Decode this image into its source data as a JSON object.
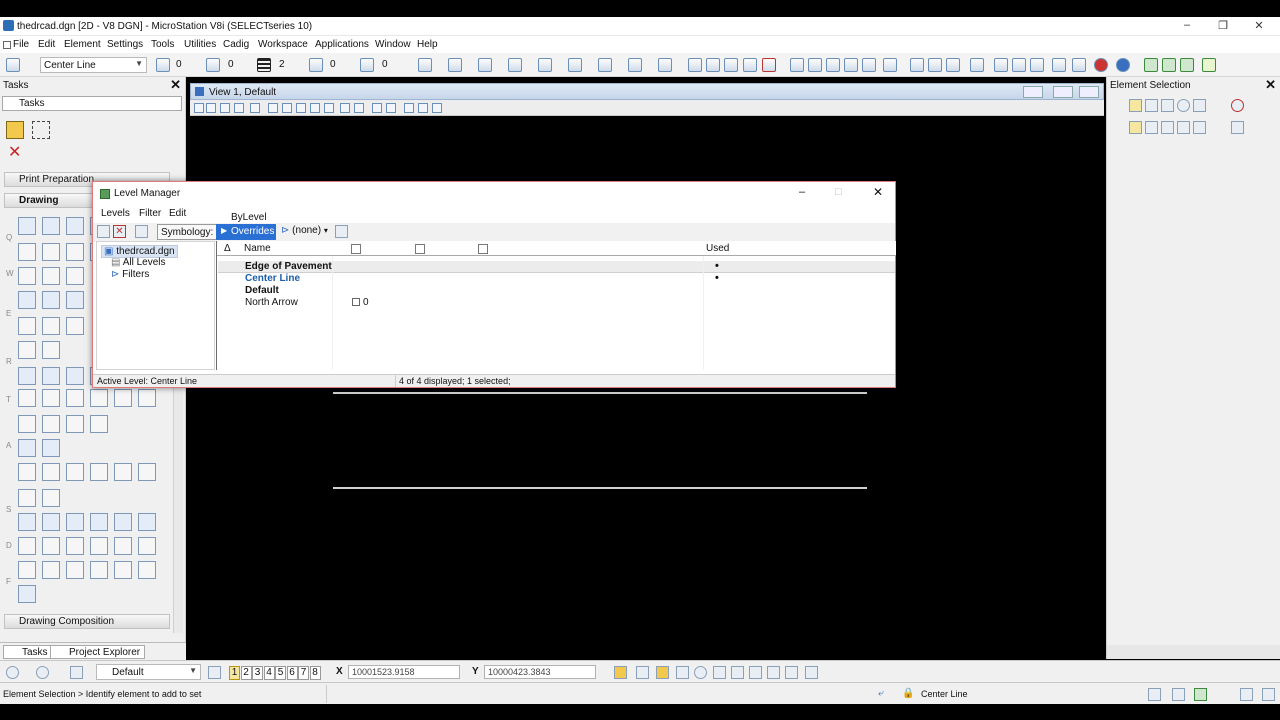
{
  "window": {
    "title": "thedrcad.dgn [2D - V8 DGN] - MicroStation V8i (SELECTseries 10)",
    "minimize": "–",
    "restore": "❐",
    "close": "✕"
  },
  "menu": [
    "File",
    "Edit",
    "Element",
    "Settings",
    "Tools",
    "Utilities",
    "Cadig",
    "Workspace",
    "Applications",
    "Window",
    "Help"
  ],
  "toolbar": {
    "level_combo": "Center Line",
    "color_value": "0",
    "style_value": "0",
    "weight_value": "2",
    "transparency_value": "0",
    "priority_value": "0"
  },
  "tasks_panel": {
    "title": "Tasks",
    "combo_value": "Tasks",
    "section_print": "Print Preparation",
    "section_drawing": "Drawing",
    "section_composition": "Drawing Composition",
    "side_letters": [
      "Q",
      "W",
      "E",
      "R",
      "T",
      "A",
      "S",
      "D",
      "F"
    ],
    "tabs": [
      "Tasks",
      "Project Explorer"
    ]
  },
  "view": {
    "title": "View 1, Default"
  },
  "right_panel": {
    "title": "Element Selection"
  },
  "level_manager": {
    "title": "Level Manager",
    "menu": [
      "Levels",
      "Filter",
      "Edit"
    ],
    "symbology_label": "Symbology:",
    "bylevel_label": "ByLevel",
    "overrides_label": "Overrides",
    "filter_label": "(none)",
    "tree": [
      "thedrcad.dgn",
      "All Levels",
      "Filters"
    ],
    "columns": {
      "sort": "Δ",
      "name": "Name",
      "used": "Used"
    },
    "rows": [
      {
        "name": "Edge of Pavement",
        "used": "•",
        "style": "bold"
      },
      {
        "name": "Center Line",
        "used": "•",
        "style": "active"
      },
      {
        "name": "Default",
        "used": "",
        "style": "bold"
      },
      {
        "name": "North Arrow",
        "used": "",
        "style": "normal",
        "extra": "0"
      }
    ],
    "status_left": "Active Level: Center Line",
    "status_right": "4 of 4 displayed; 1 selected;"
  },
  "view_bar": {
    "view_combo": "Default",
    "view_numbers": [
      "1",
      "2",
      "3",
      "4",
      "5",
      "6",
      "7",
      "8"
    ],
    "x_label": "X",
    "x_value": "10001523.9158",
    "y_label": "Y",
    "y_value": "10000423.3843"
  },
  "status_bar": {
    "prompt": "Element Selection > Identify element to add to set",
    "active_level": "Center Line"
  },
  "colors": {
    "accent": "#2a6fd4",
    "active_level_text": "#1c5fa8",
    "canvas": "#000000"
  }
}
